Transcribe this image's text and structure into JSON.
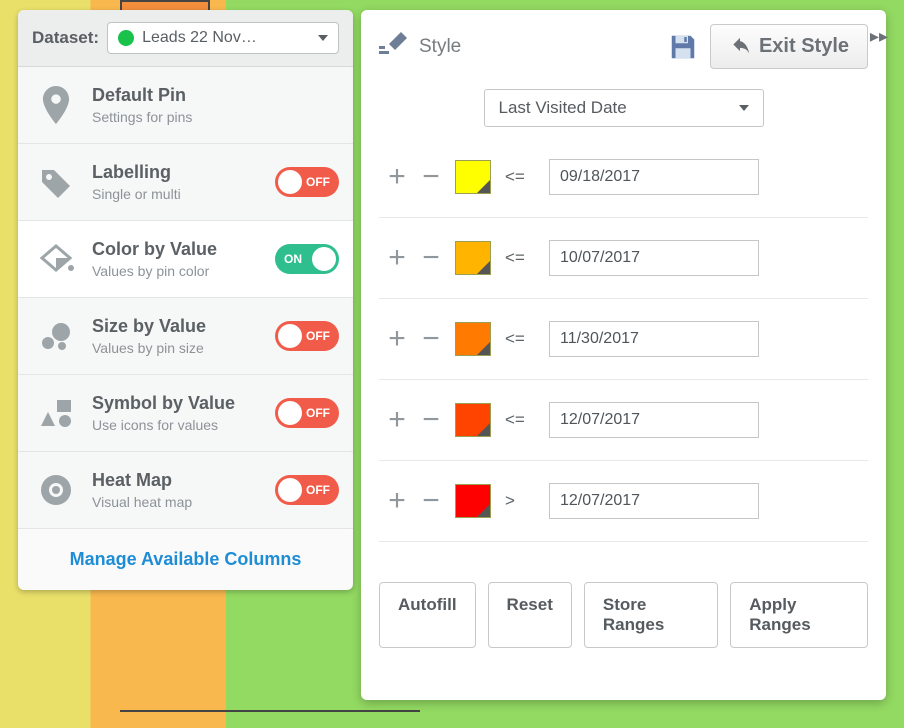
{
  "dataset": {
    "label": "Dataset:",
    "selected": "Leads 22 Nov…"
  },
  "sidebar": {
    "items": [
      {
        "title": "Default Pin",
        "sub": "Settings for pins",
        "toggle": null
      },
      {
        "title": "Labelling",
        "sub": "Single or multi",
        "toggle": "OFF"
      },
      {
        "title": "Color by Value",
        "sub": "Values by pin color",
        "toggle": "ON"
      },
      {
        "title": "Size by Value",
        "sub": "Values by pin size",
        "toggle": "OFF"
      },
      {
        "title": "Symbol by Value",
        "sub": "Use icons for values",
        "toggle": "OFF"
      },
      {
        "title": "Heat Map",
        "sub": "Visual heat map",
        "toggle": "OFF"
      }
    ],
    "manage": "Manage Available Columns"
  },
  "style": {
    "title": "Style",
    "exit": "Exit Style",
    "field": "Last Visited Date",
    "ranges": [
      {
        "color": "#ffff00",
        "op": "<=",
        "value": "09/18/2017"
      },
      {
        "color": "#ffb400",
        "op": "<=",
        "value": "10/07/2017"
      },
      {
        "color": "#ff7a00",
        "op": "<=",
        "value": "11/30/2017"
      },
      {
        "color": "#ff4400",
        "op": "<=",
        "value": "12/07/2017"
      },
      {
        "color": "#ff0000",
        "op": ">",
        "value": "12/07/2017"
      }
    ],
    "buttons": {
      "autofill": "Autofill",
      "reset": "Reset",
      "store": "Store Ranges",
      "apply": "Apply Ranges"
    }
  }
}
